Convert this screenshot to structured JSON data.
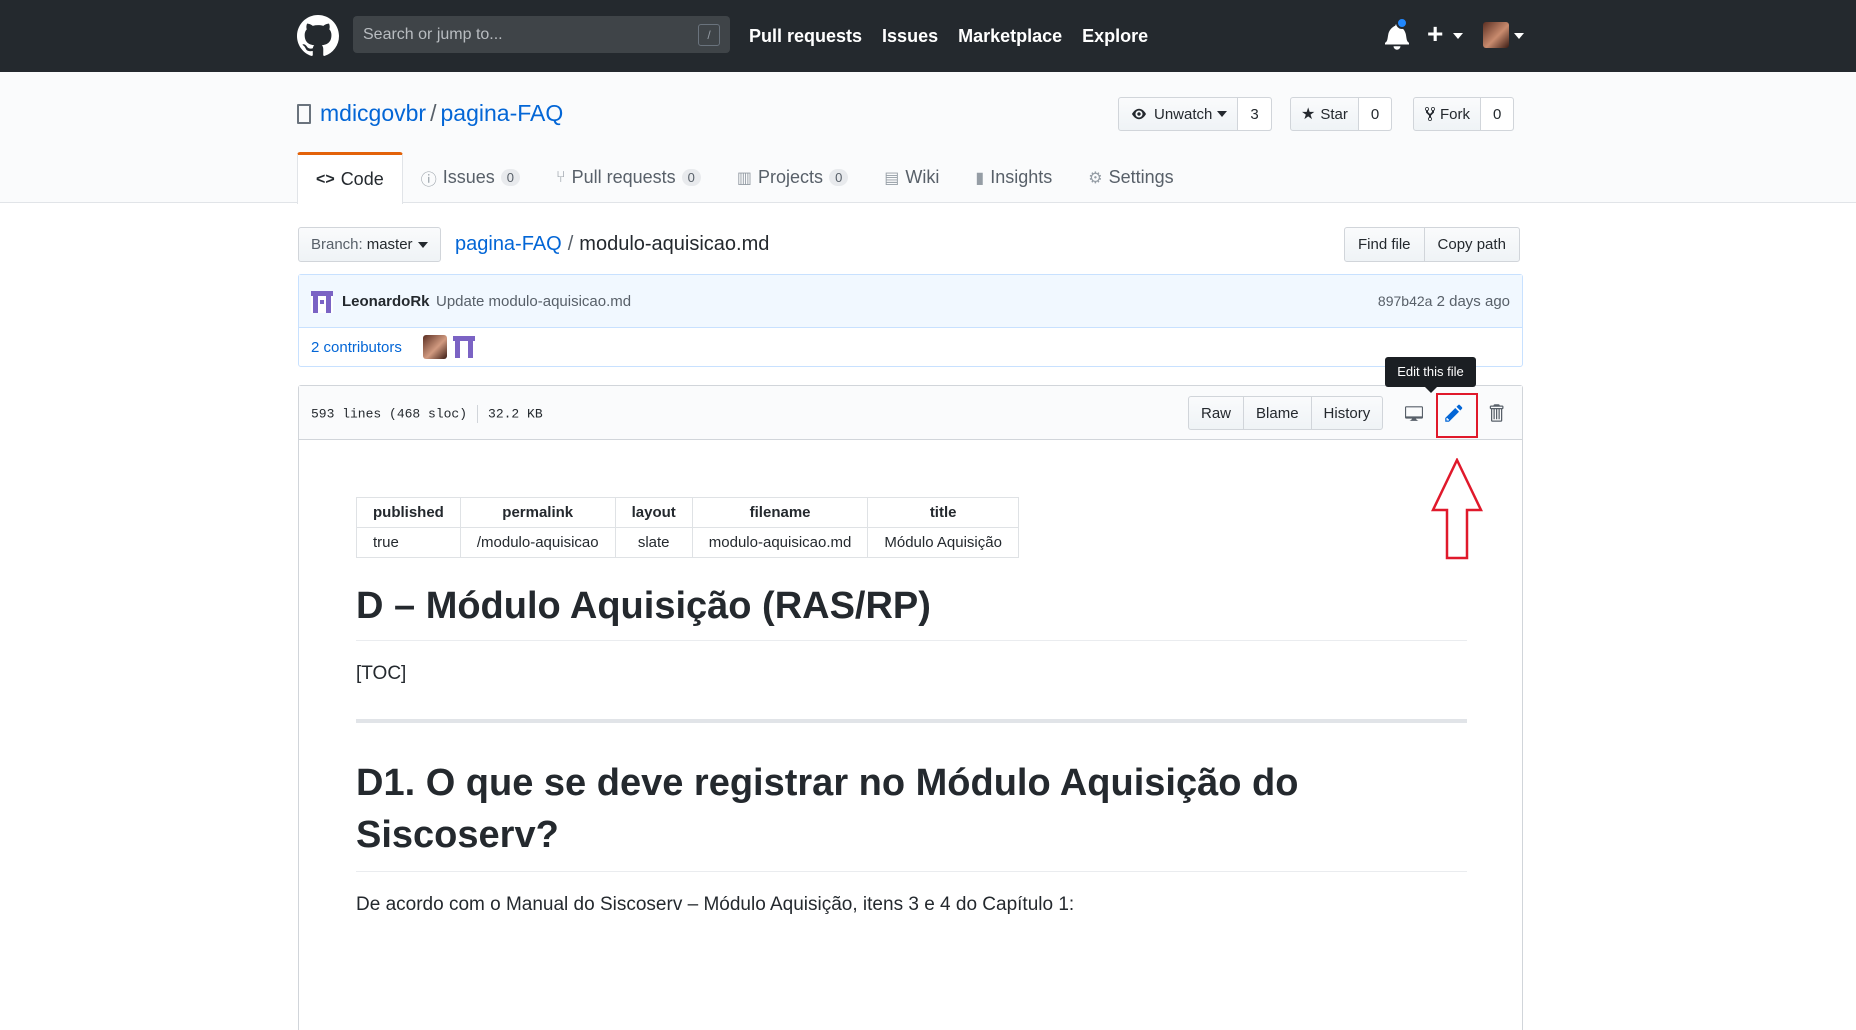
{
  "header": {
    "search_placeholder": "Search or jump to...",
    "search_key": "/",
    "nav": [
      "Pull requests",
      "Issues",
      "Marketplace",
      "Explore"
    ],
    "create_icon": "+"
  },
  "repo": {
    "owner": "mdicgovbr",
    "separator": "/",
    "name": "pagina-FAQ",
    "unwatch_label": "Unwatch",
    "watch_count": "3",
    "star_label": "Star",
    "star_count": "0",
    "fork_label": "Fork",
    "fork_count": "0"
  },
  "tabs": [
    {
      "label": "Code",
      "icon": "code-icon"
    },
    {
      "label": "Issues",
      "count": "0",
      "icon": "issue-icon"
    },
    {
      "label": "Pull requests",
      "count": "0",
      "icon": "pr-icon"
    },
    {
      "label": "Projects",
      "count": "0",
      "icon": "project-icon"
    },
    {
      "label": "Wiki",
      "icon": "book-icon"
    },
    {
      "label": "Insights",
      "icon": "graph-icon"
    },
    {
      "label": "Settings",
      "icon": "gear-icon"
    }
  ],
  "filenav": {
    "branch_label": "Branch:",
    "branch": "master",
    "crumb_repo": "pagina-FAQ",
    "crumb_sep": "/",
    "crumb_file": "modulo-aquisicao.md",
    "find_file": "Find file",
    "copy_path": "Copy path"
  },
  "commit": {
    "author": "LeonardoRk",
    "message": "Update modulo-aquisicao.md",
    "sha": "897b42a",
    "when": "2 days ago",
    "contributors": "2 contributors"
  },
  "file": {
    "lines": "593 lines (468 sloc)",
    "size": "32.2 KB",
    "raw": "Raw",
    "blame": "Blame",
    "history": "History",
    "tooltip": "Edit this file"
  },
  "markdown": {
    "table_headers": [
      "published",
      "permalink",
      "layout",
      "filename",
      "title"
    ],
    "table_row": [
      "true",
      "/modulo-aquisicao",
      "slate",
      "modulo-aquisicao.md",
      "Módulo Aquisição"
    ],
    "h1": "D – Módulo Aquisição (RAS/RP)",
    "toc": "[TOC]",
    "h1_second": "D1. O que se deve registrar no Módulo Aquisição do Siscoserv?",
    "paragraph": "De acordo com o Manual do Siscoserv – Módulo Aquisição, itens 3 e 4 do Capítulo 1:"
  },
  "colors": {
    "header_bg": "#24292e",
    "link": "#0366d6",
    "active_tab": "#e36209",
    "annotation_red": "#e0192b"
  }
}
